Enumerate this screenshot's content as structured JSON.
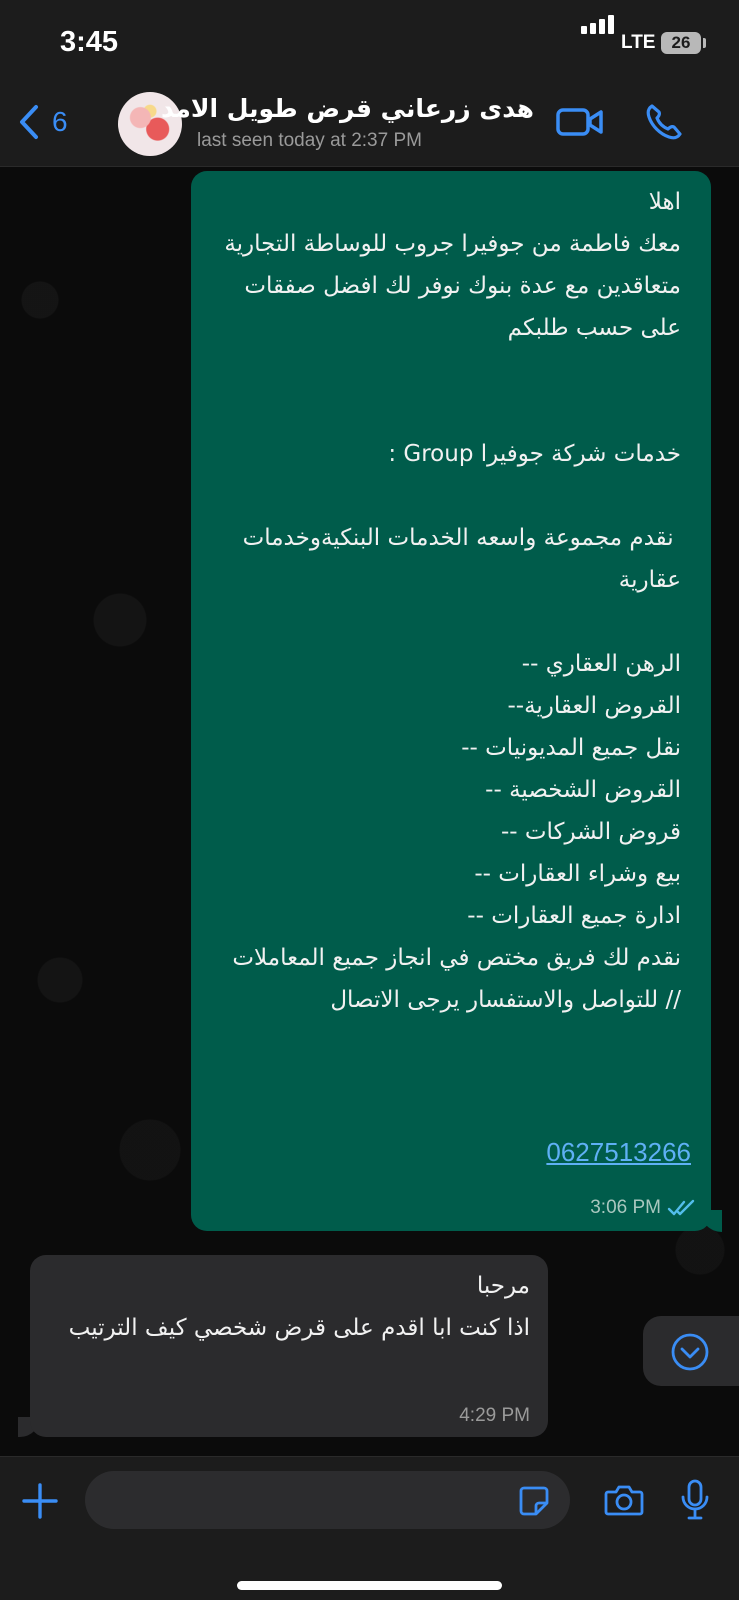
{
  "status_bar": {
    "time": "3:45",
    "network": "LTE",
    "battery": "26"
  },
  "header": {
    "back_count": "6",
    "contact_name": "هدى زرعاني قرض طويل الامد",
    "last_seen": "last seen today at 2:37 PM"
  },
  "messages": [
    {
      "direction": "outgoing",
      "text": "اهلا\nمعك فاطمة من جوفيرا جروب للوساطة التجارية  متعاقدين مع عدة بنوك نوفر لك افضل صفقات على حسب طلبكم\n\n\nخدمات شركة جوفيرا Group :\n\n نقدم مجموعة واسعه الخدمات البنكيةوخدمات عقارية\n\nالرهن العقاري --\nالقروض العقارية--\nنقل جميع المديونيات --\nالقروض الشخصية --\nقروض الشركات --\nبيع وشراء العقارات --\nادارة جميع العقارات --\nنقدم لك فريق مختص في انجاز جميع المعاملات\n// للتواصل والاستفسار يرجى الاتصال",
      "link": "0627513266",
      "time": "3:06 PM"
    },
    {
      "direction": "incoming",
      "text": "مرحبا\nاذا كنت ابا اقدم على قرض شخصي كيف الترتيب",
      "time": "4:29 PM"
    }
  ],
  "composer": {
    "placeholder": ""
  },
  "colors": {
    "accent": "#3a8df5",
    "outgoing_bubble": "#005c4b",
    "incoming_bubble": "#2b2b2d",
    "read_receipt": "#53bdeb"
  }
}
